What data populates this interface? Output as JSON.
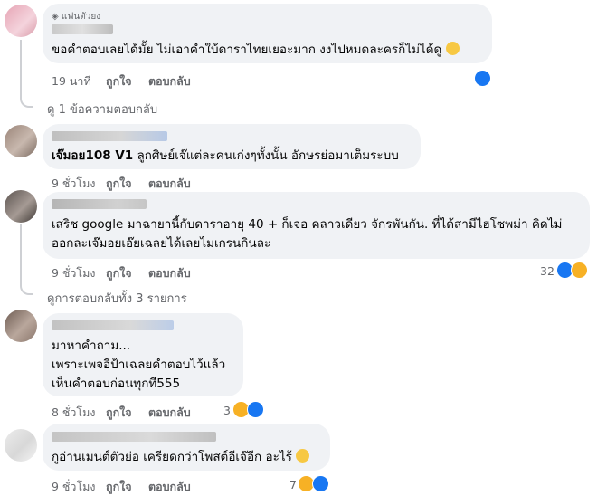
{
  "comments": [
    {
      "badge": "แฟนตัวยง",
      "text": "ขอคำตอบเลยได้มั้ย ไม่เอาคำใบ้ดาราไทยเยอะมาก งงไปหมดละครก็ไม่ได้ดู",
      "time": "19 นาที",
      "like": "ถูกใจ",
      "reply": "ตอบกลับ",
      "view_replies": "ดู 1 ข้อความตอบกลับ"
    },
    {
      "text_bold": "เจ๊มอย108 V1",
      "text": " ลูกศิษย์เจ๊แต่ละคนเก่งๆทั้งนั้น อักษรย่อมาเต็มระบบ",
      "time": "9 ชั่วโมง",
      "like": "ถูกใจ",
      "reply": "ตอบกลับ"
    },
    {
      "line1": "เสริช google มาฉายานี้กับดาราอายุ 40 + ก็เจอ คลาวเดียว จักรพันกัน. ที่ได้สามีไฮโซพม่า คิดไม่",
      "line2": "ออกละเจ๊มอยเอ๊ยเฉลยได้เลยไมเกรนกินละ",
      "time": "9 ชั่วโมง",
      "like": "ถูกใจ",
      "reply": "ตอบกลับ",
      "reactions": "32",
      "view_replies": "ดูการตอบกลับทั้ง 3 รายการ"
    },
    {
      "line1": "มาหาคำถาม...",
      "line2": "เพราะเพจอีป้าเฉลยคำตอบไว้แล้ว",
      "line3": "เห็นคำตอบก่อนทุกที555",
      "time": "8 ชั่วโมง",
      "like": "ถูกใจ",
      "reply": "ตอบกลับ",
      "reactions": "3"
    },
    {
      "text": "กูอ่านเมนต์ตัวย่อ เครียดกว่าโพสต์อีเจ๊อีก อะไร้",
      "time": "9 ชั่วโมง",
      "like": "ถูกใจ",
      "reply": "ตอบกลับ",
      "reactions": "7"
    }
  ],
  "colors": {
    "link": "#1877f2",
    "meta": "#65676b",
    "bubble": "#f0f2f5"
  }
}
